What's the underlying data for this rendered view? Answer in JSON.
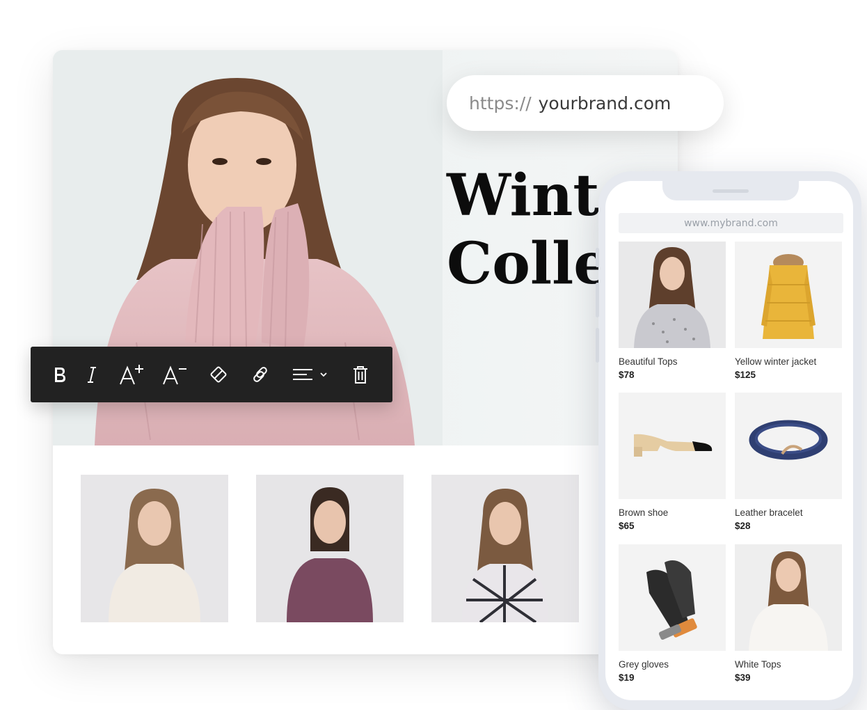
{
  "desktop": {
    "hero_title": "Winter\nCollection"
  },
  "url_bar": {
    "prefix": "https://",
    "domain": "yourbrand.com"
  },
  "toolbar": {
    "tools": [
      "bold-icon",
      "italic-icon",
      "increase-font-size-icon",
      "decrease-font-size-icon",
      "clear-format-icon",
      "link-icon",
      "align-dropdown-icon",
      "delete-icon"
    ]
  },
  "phone": {
    "url": "www.mybrand.com",
    "products": [
      {
        "name": "Beautiful Tops",
        "price": "$78"
      },
      {
        "name": "Yellow winter jacket",
        "price": "$125"
      },
      {
        "name": "Brown shoe",
        "price": "$65"
      },
      {
        "name": "Leather bracelet",
        "price": "$28"
      },
      {
        "name": "Grey gloves",
        "price": "$19"
      },
      {
        "name": "White Tops",
        "price": "$39"
      }
    ]
  },
  "colors": {
    "toolbar_bg": "#222222",
    "phone_frame": "#e6e9ef",
    "hero_bg": "#eef2f2"
  }
}
